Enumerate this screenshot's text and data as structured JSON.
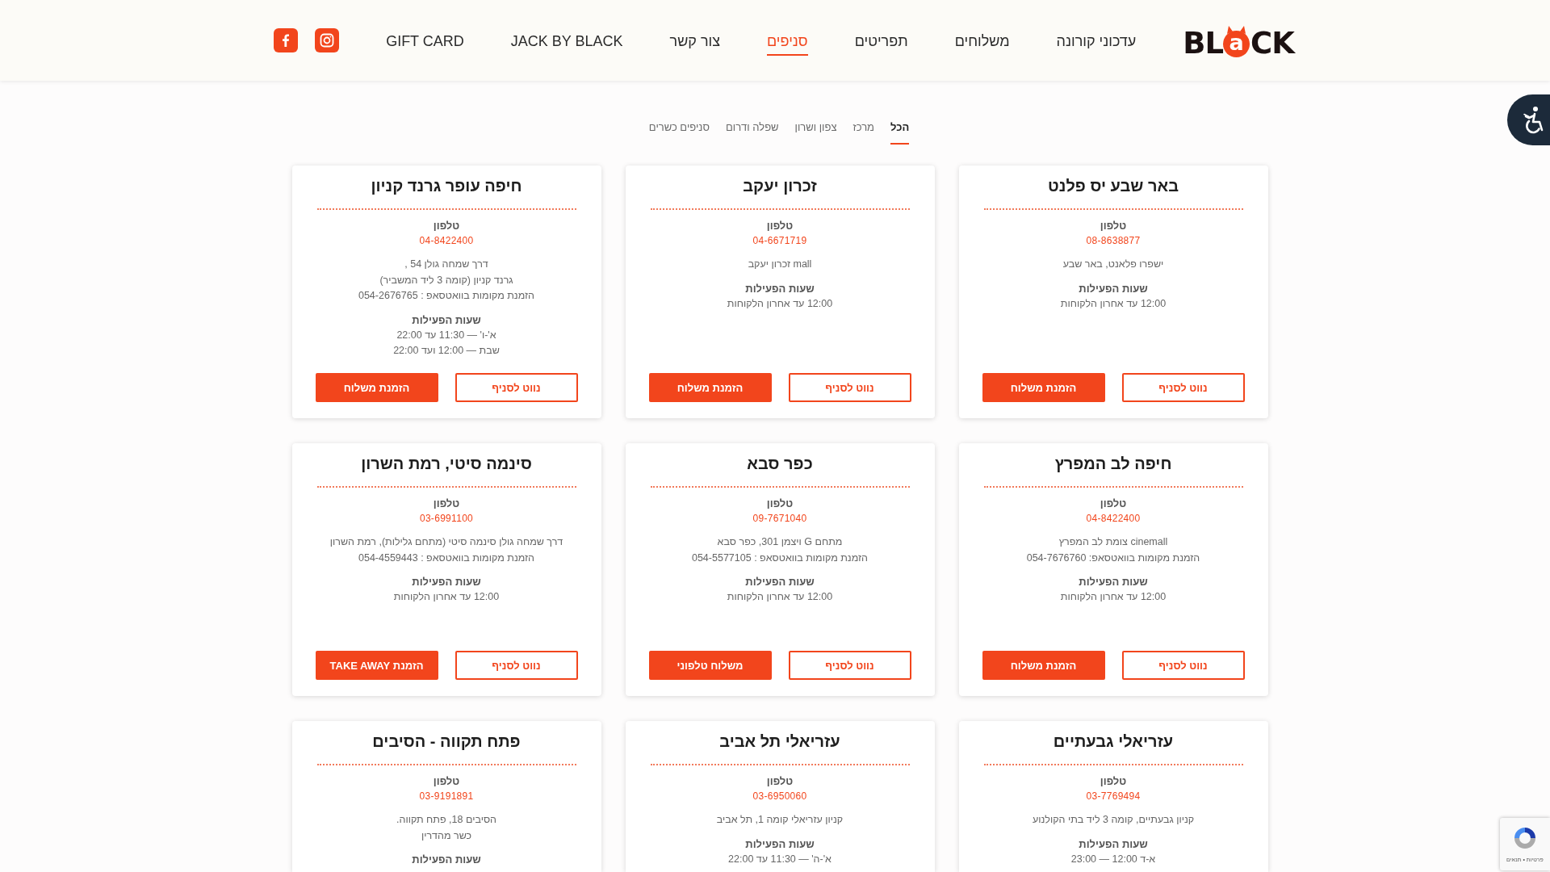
{
  "header": {
    "logo": {
      "lead": "BL",
      "mark": "a",
      "tail": "CK"
    },
    "nav": [
      {
        "label": "עדכוני קורונה",
        "selected": false
      },
      {
        "label": "משלוחים",
        "selected": false
      },
      {
        "label": "תפריטים",
        "selected": false
      },
      {
        "label": "סניפים",
        "selected": true
      },
      {
        "label": "צור קשר",
        "selected": false
      },
      {
        "label": "JACK BY BLACK",
        "selected": false
      },
      {
        "label": "GIFT CARD",
        "selected": false
      }
    ],
    "social": [
      {
        "kind": "instagram"
      },
      {
        "kind": "facebook"
      }
    ]
  },
  "filter_tabs": [
    {
      "label": "הכל",
      "selected": true
    },
    {
      "label": "מרכז",
      "selected": false
    },
    {
      "label": "צפון ושרון",
      "selected": false
    },
    {
      "label": "שפלה ודרום",
      "selected": false
    },
    {
      "label": "סניפים כשרים",
      "selected": false
    }
  ],
  "branches": [
    {
      "name": "באר שבע יס פלנט",
      "phone_label": "טלפון",
      "phone": "08-8638877",
      "address": [
        "ישפרו פלאנט, באר שבע"
      ],
      "hours_label": "שעות הפעילות",
      "hours": [
        "12:00 עד אחרון הלקוחות"
      ],
      "buttons": [
        {
          "label": "נווט לסניף",
          "kind": "navigate"
        },
        {
          "label": "הזמנת משלוח",
          "kind": "order"
        }
      ]
    },
    {
      "name": "זכרון יעקב",
      "phone_label": "טלפון",
      "phone": "04-6671719",
      "address": [
        "mall זכרון יעקב"
      ],
      "hours_label": "שעות הפעילות",
      "hours": [
        "12:00 עד אחרון הלקוחות"
      ],
      "buttons": [
        {
          "label": "נווט לסניף",
          "kind": "navigate"
        },
        {
          "label": "הזמנת משלוח",
          "kind": "order"
        }
      ]
    },
    {
      "name": "חיפה עופר גרנד קניון",
      "phone_label": "טלפון",
      "phone": "04-8422400",
      "address": [
        "דרך שמחה גולן 54 ,",
        "גרנד קניון (קומה 3 ליד המשביר)",
        "הזמנת מקומות בוואטסאפ : 054-2676765"
      ],
      "hours_label": "שעות הפעילות",
      "hours": [
        "א'-ו' — 11:30 עד 22:00",
        "שבת — 12:00 ועד 22:00"
      ],
      "buttons": [
        {
          "label": "נווט לסניף",
          "kind": "navigate"
        },
        {
          "label": "הזמנת משלוח",
          "kind": "order"
        }
      ]
    },
    {
      "name": "חיפה לב המפרץ",
      "phone_label": "טלפון",
      "phone": "04-8422400",
      "address": [
        "cinemall צומת לב המפרץ",
        "הזמנת מקומות בוואטסאפ: 054-7676760"
      ],
      "hours_label": "שעות הפעילות",
      "hours": [
        "12:00 עד אחרון הלקוחות"
      ],
      "buttons": [
        {
          "label": "נווט לסניף",
          "kind": "navigate"
        },
        {
          "label": "הזמנת משלוח",
          "kind": "order"
        }
      ]
    },
    {
      "name": "כפר סבא",
      "phone_label": "טלפון",
      "phone": "09-7671040",
      "address": [
        "מתחם G ויצמן 301, כפר סבא",
        "הזמנת מקומות בוואטסאפ : 054-5577105"
      ],
      "hours_label": "שעות הפעילות",
      "hours": [
        "12:00 עד אחרון הלקוחות"
      ],
      "buttons": [
        {
          "label": "נווט לסניף",
          "kind": "navigate"
        },
        {
          "label": "משלוח טלפוני",
          "kind": "order"
        }
      ]
    },
    {
      "name": "סינמה סיטי, רמת השרון",
      "phone_label": "טלפון",
      "phone": "03-6991100",
      "address": [
        "דרך שמחה גולן סינמה סיטי (מתחם גלילות), רמת השרון",
        "הזמנת מקומות בוואטסאפ : 054-4559443"
      ],
      "hours_label": "שעות הפעילות",
      "hours": [
        "12:00 עד אחרון הלקוחות"
      ],
      "buttons": [
        {
          "label": "נווט לסניף",
          "kind": "navigate"
        },
        {
          "label": "הזמנת TAKE AWAY",
          "kind": "order"
        }
      ]
    },
    {
      "name": "עזריאלי גבעתיים",
      "phone_label": "טלפון",
      "phone": "03-7769494",
      "address": [
        "קניון גבעתיים, קומה 3 ליד בתי הקולנוע"
      ],
      "hours_label": "שעות הפעילות",
      "hours": [
        "א-ד 12:00 — 23:00"
      ]
    },
    {
      "name": "עזריאלי תל אביב",
      "phone_label": "טלפון",
      "phone": "03-6950060",
      "address": [
        "קניון עזריאלי קומה 1, תל אביב"
      ],
      "hours_label": "שעות הפעילות",
      "hours": [
        "א'-ה' — 11:30 עד 22:00"
      ]
    },
    {
      "name": "פתח תקווה - הסיבים",
      "phone_label": "טלפון",
      "phone": "03-9191891",
      "address": [
        "הסיבים 18, פתח תקווה.",
        "כשר מהדרין"
      ],
      "hours_label": "שעות הפעילות"
    }
  ],
  "captcha": {
    "links": "פרטיות • תנאים"
  }
}
